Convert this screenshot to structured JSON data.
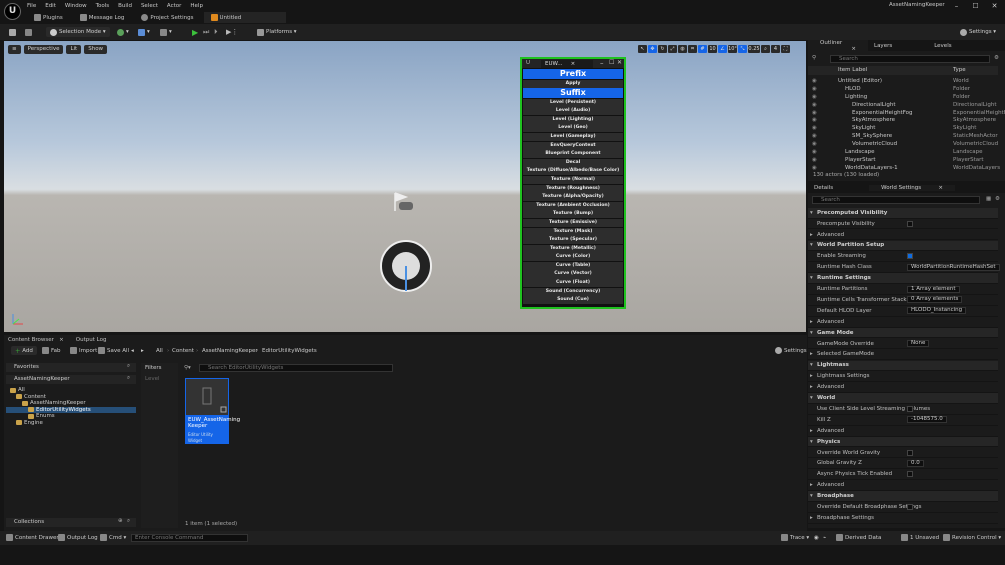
{
  "app": {
    "logo": "U",
    "window_title": "AssetNamingKeeper"
  },
  "menu": [
    "File",
    "Edit",
    "Window",
    "Tools",
    "Build",
    "Select",
    "Actor",
    "Help"
  ],
  "tabs": [
    {
      "label": "Plugins"
    },
    {
      "label": "Message Log"
    },
    {
      "label": "Project Settings"
    },
    {
      "label": "Untitled"
    }
  ],
  "toolbar": {
    "selection_mode": "Selection Mode",
    "platforms": "Platforms",
    "settings": "Settings"
  },
  "viewport": {
    "perspective": "Perspective",
    "lit": "Lit",
    "show": "Show",
    "right_values": [
      "10",
      "10°",
      "0.25",
      "4"
    ]
  },
  "widget": {
    "tab_prefix": "U",
    "tab_label": "EUW...",
    "prefix_label": "Prefix",
    "apply_label": "Apply",
    "suffix_label": "Suffix",
    "items": [
      "Level (Persistent)",
      "Level (Audio)",
      "Level (Lighting)",
      "Level (Geo)",
      "Level (Gameplay)",
      "EnvQueryContext",
      "Blueprint Component",
      "Decal",
      "Texture (Diffuse/Albedo/Base Color)",
      "Texture (Normal)",
      "Texture (Roughness)",
      "Texture (Alpha/Opacity)",
      "Texture (Ambient Occlusion)",
      "Texture (Bump)",
      "Texture (Emissive)",
      "Texture (Mask)",
      "Texture (Specular)",
      "Texture (Metallic)",
      "Curve (Color)",
      "Curve (Table)",
      "Curve (Vector)",
      "Curve (Float)",
      "Sound (Concurrency)",
      "Sound (Cue)"
    ]
  },
  "outliner": {
    "tabs": [
      "Outliner",
      "Layers",
      "Levels"
    ],
    "search_placeholder": "Search",
    "col_label": "Item Label",
    "col_type": "Type",
    "rows": [
      {
        "label": "Untitled (Editor)",
        "type": "World",
        "indent": 0
      },
      {
        "label": "HLOD",
        "type": "Folder",
        "indent": 1
      },
      {
        "label": "Lighting",
        "type": "Folder",
        "indent": 1
      },
      {
        "label": "DirectionalLight",
        "type": "DirectionalLight",
        "indent": 2
      },
      {
        "label": "ExponentialHeightFog",
        "type": "ExponentialHeightFog",
        "indent": 2
      },
      {
        "label": "SkyAtmosphere",
        "type": "SkyAtmosphere",
        "indent": 2
      },
      {
        "label": "SkyLight",
        "type": "SkyLight",
        "indent": 2
      },
      {
        "label": "SM_SkySphere",
        "type": "StaticMeshActor",
        "indent": 2
      },
      {
        "label": "VolumetricCloud",
        "type": "VolumetricCloud",
        "indent": 2
      },
      {
        "label": "Landscape",
        "type": "Landscape",
        "indent": 1
      },
      {
        "label": "PlayerStart",
        "type": "PlayerStart",
        "indent": 1
      },
      {
        "label": "WorldDataLayers-1",
        "type": "WorldDataLayers",
        "indent": 1
      }
    ],
    "footer": "130 actors (130 loaded)"
  },
  "details": {
    "tabs": [
      "Details",
      "World Settings"
    ],
    "search_placeholder": "Search",
    "rows": [
      {
        "kind": "sec",
        "label": "Precomputed Visibility"
      },
      {
        "kind": "chk",
        "label": "Precompute Visibility",
        "on": false
      },
      {
        "kind": "sub",
        "label": "Advanced"
      },
      {
        "kind": "sec",
        "label": "World Partition Setup"
      },
      {
        "kind": "chk",
        "label": "Enable Streaming",
        "on": true
      },
      {
        "kind": "val",
        "label": "Runtime Hash Class",
        "value": "WorldPartitionRuntimeHashSet"
      },
      {
        "kind": "sec",
        "label": "Runtime Settings"
      },
      {
        "kind": "val",
        "label": "Runtime Partitions",
        "value": "1 Array element"
      },
      {
        "kind": "val",
        "label": "Runtime Cells Transformer Stack",
        "value": "0 Array elements"
      },
      {
        "kind": "val",
        "label": "Default HLOD Layer",
        "value": "HLODO_Instancing"
      },
      {
        "kind": "sub",
        "label": "Advanced"
      },
      {
        "kind": "sec",
        "label": "Game Mode"
      },
      {
        "kind": "val",
        "label": "GameMode Override",
        "value": "None"
      },
      {
        "kind": "sub",
        "label": "Selected GameMode"
      },
      {
        "kind": "sec",
        "label": "Lightmass"
      },
      {
        "kind": "sub",
        "label": "Lightmass Settings"
      },
      {
        "kind": "sub",
        "label": "Advanced"
      },
      {
        "kind": "sec",
        "label": "World"
      },
      {
        "kind": "chk",
        "label": "Use Client Side Level Streaming Volumes",
        "on": false
      },
      {
        "kind": "val",
        "label": "Kill Z",
        "value": "-1048575.0"
      },
      {
        "kind": "sub",
        "label": "Advanced"
      },
      {
        "kind": "sec",
        "label": "Physics"
      },
      {
        "kind": "chk",
        "label": "Override World Gravity",
        "on": false
      },
      {
        "kind": "val",
        "label": "Global Gravity Z",
        "value": "0.0"
      },
      {
        "kind": "chk",
        "label": "Async Physics Tick Enabled",
        "on": false
      },
      {
        "kind": "sub",
        "label": "Advanced"
      },
      {
        "kind": "sec",
        "label": "Broadphase"
      },
      {
        "kind": "chk",
        "label": "Override Default Broadphase Settings",
        "on": false
      },
      {
        "kind": "sub",
        "label": "Broadphase Settings"
      }
    ]
  },
  "content_browser": {
    "tabs": [
      "Content Browser",
      "Output Log"
    ],
    "add": "Add",
    "fab": "Fab",
    "import": "Import",
    "save_all": "Save All",
    "path": [
      "All",
      "Content",
      "AssetNamingKeeper",
      "EditorUtilityWidgets"
    ],
    "settings": "Settings",
    "favorites": "Favorites",
    "project": "AssetNamingKeeper",
    "tree": [
      {
        "label": "All",
        "indent": 0
      },
      {
        "label": "Content",
        "indent": 1
      },
      {
        "label": "AssetNamingKeeper",
        "indent": 2
      },
      {
        "label": "EditorUtilityWidgets",
        "indent": 3,
        "selected": true
      },
      {
        "label": "Enums",
        "indent": 3
      },
      {
        "label": "Engine",
        "indent": 1
      }
    ],
    "collections": "Collections",
    "filters_label": "Filters",
    "filter_chip": "Level",
    "search_placeholder": "Search EditorUtilityWidgets",
    "asset_name": "EUW_AssetNaming Keeper",
    "asset_type": "Editor Utility Widget",
    "status": "1 item (1 selected)"
  },
  "statusbar": {
    "content_drawer": "Content Drawer",
    "output_log": "Output Log",
    "cmd": "Cmd",
    "console_placeholder": "Enter Console Command",
    "trace": "Trace",
    "derived_data": "Derived Data",
    "unsaved": "1 Unsaved",
    "revision": "Revision Control"
  },
  "colors": {
    "accent": "#1565e8",
    "widget_border": "#1fc21f",
    "selection": "#264f78"
  }
}
